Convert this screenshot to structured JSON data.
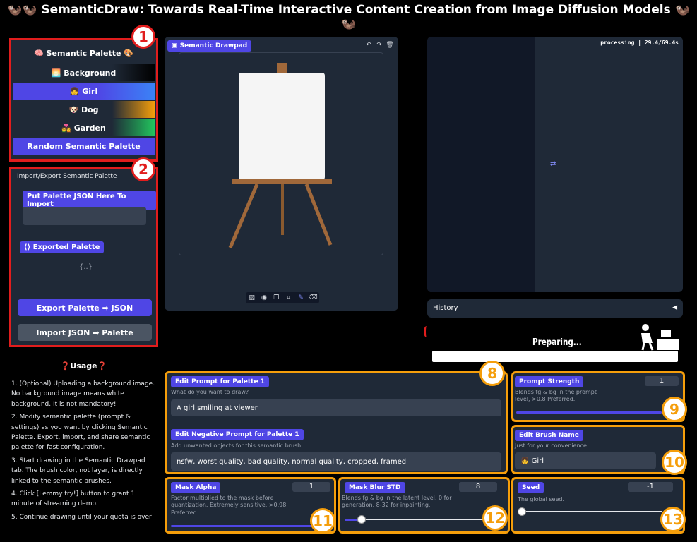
{
  "title": "🦦🦦 SemanticDraw: Towards Real-Time Interactive Content Creation from Image Diffusion Models 🦦🦦",
  "palette": {
    "header": "🧠 Semantic Palette 🎨",
    "items": [
      {
        "label": "🌅 Background"
      },
      {
        "label": "👧 Girl"
      },
      {
        "label": "🐶 Dog"
      },
      {
        "label": "💑 Garden"
      }
    ],
    "random_label": "Random Semantic Palette"
  },
  "import_export": {
    "heading": "Import/Export Semantic Palette",
    "import_label": "Put Palette JSON Here To Import",
    "exported_label": "Exported Palette",
    "exported_value": "{..}",
    "export_btn": "Export Palette ➡ JSON",
    "import_btn": "Import JSON ➡ Palette"
  },
  "usage": {
    "title": "❓Usage❓",
    "steps": [
      "1. (Optional) Uploading a background image. No background image means white background. It is not mandatory!",
      "2. Modify semantic palette (prompt & settings) as you want by clicking Semantic Palette. Export, import, and share semantic palette for fast configuration.",
      "3. Start drawing in the Semantic Drawpad tab. The brush color, not layer, is directly linked to the semantic brushes.",
      "4. Click [Lemmy try!] button to grant 1 minute of streaming demo.",
      "5. Continue drawing until your quota is over!"
    ]
  },
  "drawpad": {
    "label": "Semantic Drawpad"
  },
  "output": {
    "status": "processing | 29.4/69.4s",
    "history_label": "History",
    "preparing": "Preparing..."
  },
  "prompt": {
    "label": "Edit Prompt for Palette 1",
    "hint": "What do you want to draw?",
    "value": "A girl smiling at viewer",
    "neg_label": "Edit Negative Prompt for Palette 1",
    "neg_hint": "Add unwanted objects for this semantic brush.",
    "neg_value": "nsfw, worst quality, bad quality, normal quality, cropped, framed"
  },
  "strength": {
    "label": "Prompt Strength",
    "value": "1",
    "hint": "Blends fg & bg in the prompt level, >0.8 Preferred."
  },
  "brush": {
    "label": "Edit Brush Name",
    "hint": "Just for your convenience.",
    "value": "👧 Girl"
  },
  "mask_alpha": {
    "label": "Mask Alpha",
    "value": "1",
    "hint": "Factor multiplied to the mask before quantization. Extremely sensitive, >0.98 Preferred."
  },
  "mask_blur": {
    "label": "Mask Blur STD",
    "value": "8",
    "hint": "Blends fg & bg in the latent level, 0 for generation, 8-32 for inpainting."
  },
  "seed": {
    "label": "Seed",
    "value": "-1",
    "hint": "The global seed."
  },
  "annotations": [
    "1",
    "2",
    "8",
    "9",
    "10",
    "11",
    "12",
    "13"
  ],
  "colors": {
    "accent": "#4f46e5",
    "panel": "#1f2937",
    "orange": "#f59e0b",
    "red": "#e11d1d"
  }
}
